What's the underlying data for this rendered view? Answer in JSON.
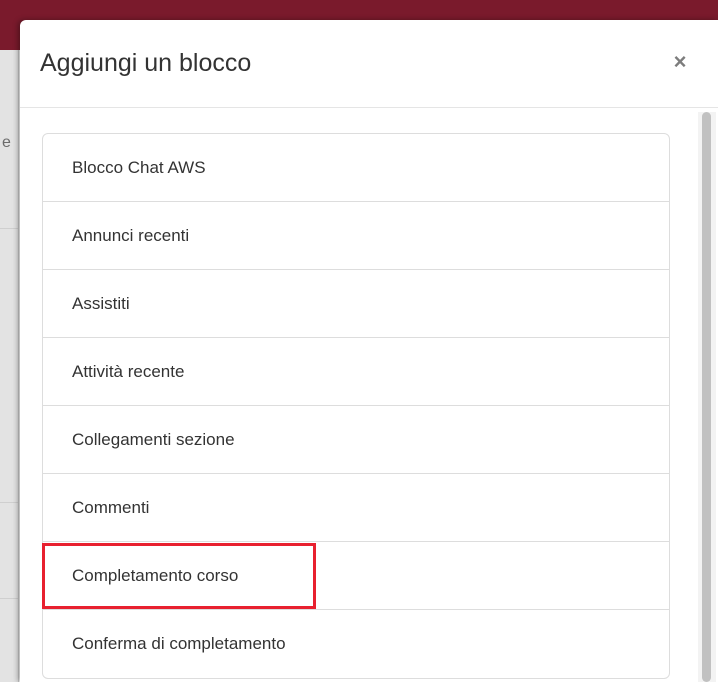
{
  "modal": {
    "title": "Aggiungi un blocco",
    "close_glyph": "×",
    "close_icon": "close-icon"
  },
  "background": {
    "fragment": "e"
  },
  "blocks": {
    "items": [
      {
        "label": "Blocco Chat AWS"
      },
      {
        "label": "Annunci recenti"
      },
      {
        "label": "Assistiti"
      },
      {
        "label": "Attività recente"
      },
      {
        "label": "Collegamenti sezione"
      },
      {
        "label": "Commenti"
      },
      {
        "label": "Completamento corso",
        "highlighted": true
      },
      {
        "label": "Conferma di completamento"
      }
    ]
  },
  "colors": {
    "brand_topbar": "#7a1a2c",
    "highlight": "#e8202f"
  }
}
